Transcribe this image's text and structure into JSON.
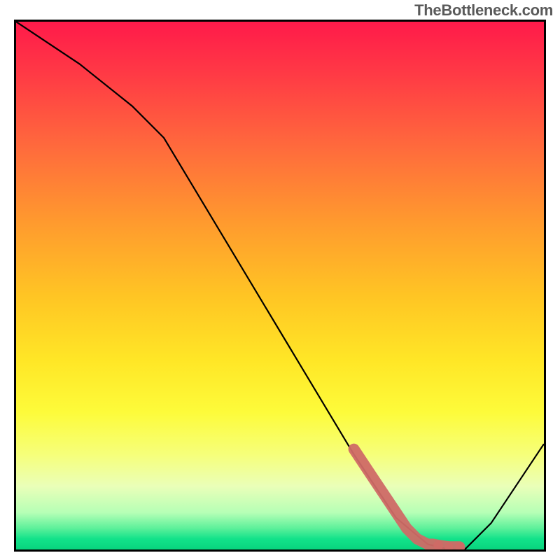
{
  "watermark": "TheBottleneck.com",
  "chart_data": {
    "type": "line",
    "title": "",
    "xlabel": "",
    "ylabel": "",
    "xlim": [
      0,
      100
    ],
    "ylim": [
      0,
      100
    ],
    "grid": false,
    "series": [
      {
        "name": "curve",
        "x": [
          0,
          12,
          22,
          28,
          40,
          52,
          64,
          72,
          78,
          82,
          85,
          90,
          100
        ],
        "values": [
          100,
          92,
          84,
          78,
          58,
          38,
          18,
          6,
          1,
          0,
          0,
          5,
          20
        ]
      }
    ],
    "markers": {
      "name": "highlight-segment",
      "color": "#cf6a66",
      "x": [
        64,
        68,
        72,
        74,
        76,
        78,
        79,
        80,
        82,
        84
      ],
      "values": [
        19,
        13,
        7,
        4,
        2,
        1,
        1,
        0.8,
        0.5,
        0.5
      ]
    },
    "background": "rainbow-gradient"
  }
}
